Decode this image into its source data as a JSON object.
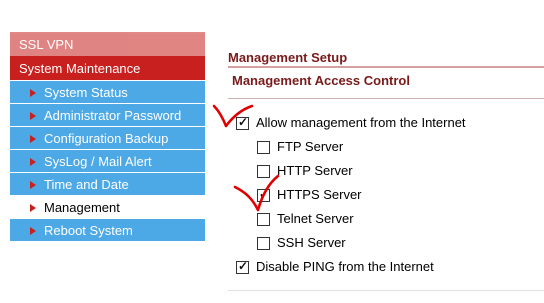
{
  "sidebar": {
    "top_item": "SSL VPN",
    "section": "System Maintenance",
    "items": [
      {
        "label": "System Status",
        "active": false
      },
      {
        "label": "Administrator Password",
        "active": false
      },
      {
        "label": "Configuration Backup",
        "active": false
      },
      {
        "label": "SysLog / Mail Alert",
        "active": false
      },
      {
        "label": "Time and Date",
        "active": false
      },
      {
        "label": "Management",
        "active": true
      },
      {
        "label": "Reboot System",
        "active": false
      }
    ]
  },
  "main": {
    "title": "Management Setup",
    "section_title": "Management Access Control",
    "options": {
      "allow_internet": {
        "label": "Allow management from the Internet",
        "checked": true
      },
      "ftp": {
        "label": "FTP Server",
        "checked": false
      },
      "http": {
        "label": "HTTP Server",
        "checked": false
      },
      "https": {
        "label": "HTTPS Server",
        "checked": true
      },
      "telnet": {
        "label": "Telnet Server",
        "checked": false
      },
      "ssh": {
        "label": "SSH Server",
        "checked": false
      },
      "disable_ping": {
        "label": "Disable PING from the Internet",
        "checked": true
      }
    }
  },
  "colors": {
    "sidebar_section": "#c8201e",
    "sidebar_item": "#4da8e6",
    "heading": "#7a1a1a",
    "annotation": "#e00000"
  }
}
